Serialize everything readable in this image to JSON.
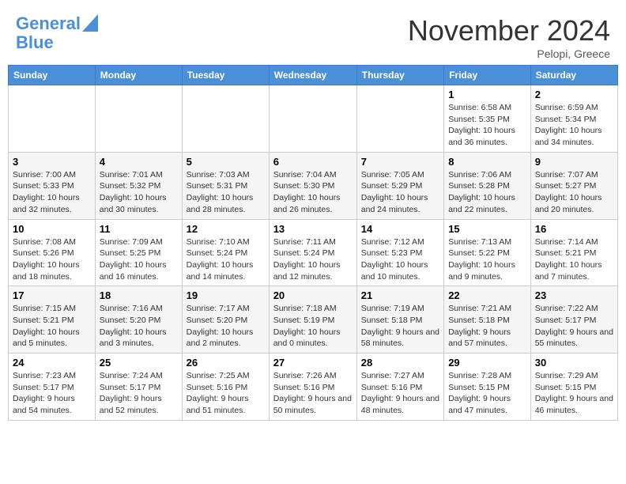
{
  "header": {
    "logo_line1": "General",
    "logo_line2": "Blue",
    "month": "November 2024",
    "location": "Pelopi, Greece"
  },
  "weekdays": [
    "Sunday",
    "Monday",
    "Tuesday",
    "Wednesday",
    "Thursday",
    "Friday",
    "Saturday"
  ],
  "weeks": [
    [
      {
        "day": "",
        "info": ""
      },
      {
        "day": "",
        "info": ""
      },
      {
        "day": "",
        "info": ""
      },
      {
        "day": "",
        "info": ""
      },
      {
        "day": "",
        "info": ""
      },
      {
        "day": "1",
        "info": "Sunrise: 6:58 AM\nSunset: 5:35 PM\nDaylight: 10 hours and 36 minutes."
      },
      {
        "day": "2",
        "info": "Sunrise: 6:59 AM\nSunset: 5:34 PM\nDaylight: 10 hours and 34 minutes."
      }
    ],
    [
      {
        "day": "3",
        "info": "Sunrise: 7:00 AM\nSunset: 5:33 PM\nDaylight: 10 hours and 32 minutes."
      },
      {
        "day": "4",
        "info": "Sunrise: 7:01 AM\nSunset: 5:32 PM\nDaylight: 10 hours and 30 minutes."
      },
      {
        "day": "5",
        "info": "Sunrise: 7:03 AM\nSunset: 5:31 PM\nDaylight: 10 hours and 28 minutes."
      },
      {
        "day": "6",
        "info": "Sunrise: 7:04 AM\nSunset: 5:30 PM\nDaylight: 10 hours and 26 minutes."
      },
      {
        "day": "7",
        "info": "Sunrise: 7:05 AM\nSunset: 5:29 PM\nDaylight: 10 hours and 24 minutes."
      },
      {
        "day": "8",
        "info": "Sunrise: 7:06 AM\nSunset: 5:28 PM\nDaylight: 10 hours and 22 minutes."
      },
      {
        "day": "9",
        "info": "Sunrise: 7:07 AM\nSunset: 5:27 PM\nDaylight: 10 hours and 20 minutes."
      }
    ],
    [
      {
        "day": "10",
        "info": "Sunrise: 7:08 AM\nSunset: 5:26 PM\nDaylight: 10 hours and 18 minutes."
      },
      {
        "day": "11",
        "info": "Sunrise: 7:09 AM\nSunset: 5:25 PM\nDaylight: 10 hours and 16 minutes."
      },
      {
        "day": "12",
        "info": "Sunrise: 7:10 AM\nSunset: 5:24 PM\nDaylight: 10 hours and 14 minutes."
      },
      {
        "day": "13",
        "info": "Sunrise: 7:11 AM\nSunset: 5:24 PM\nDaylight: 10 hours and 12 minutes."
      },
      {
        "day": "14",
        "info": "Sunrise: 7:12 AM\nSunset: 5:23 PM\nDaylight: 10 hours and 10 minutes."
      },
      {
        "day": "15",
        "info": "Sunrise: 7:13 AM\nSunset: 5:22 PM\nDaylight: 10 hours and 9 minutes."
      },
      {
        "day": "16",
        "info": "Sunrise: 7:14 AM\nSunset: 5:21 PM\nDaylight: 10 hours and 7 minutes."
      }
    ],
    [
      {
        "day": "17",
        "info": "Sunrise: 7:15 AM\nSunset: 5:21 PM\nDaylight: 10 hours and 5 minutes."
      },
      {
        "day": "18",
        "info": "Sunrise: 7:16 AM\nSunset: 5:20 PM\nDaylight: 10 hours and 3 minutes."
      },
      {
        "day": "19",
        "info": "Sunrise: 7:17 AM\nSunset: 5:20 PM\nDaylight: 10 hours and 2 minutes."
      },
      {
        "day": "20",
        "info": "Sunrise: 7:18 AM\nSunset: 5:19 PM\nDaylight: 10 hours and 0 minutes."
      },
      {
        "day": "21",
        "info": "Sunrise: 7:19 AM\nSunset: 5:18 PM\nDaylight: 9 hours and 58 minutes."
      },
      {
        "day": "22",
        "info": "Sunrise: 7:21 AM\nSunset: 5:18 PM\nDaylight: 9 hours and 57 minutes."
      },
      {
        "day": "23",
        "info": "Sunrise: 7:22 AM\nSunset: 5:17 PM\nDaylight: 9 hours and 55 minutes."
      }
    ],
    [
      {
        "day": "24",
        "info": "Sunrise: 7:23 AM\nSunset: 5:17 PM\nDaylight: 9 hours and 54 minutes."
      },
      {
        "day": "25",
        "info": "Sunrise: 7:24 AM\nSunset: 5:17 PM\nDaylight: 9 hours and 52 minutes."
      },
      {
        "day": "26",
        "info": "Sunrise: 7:25 AM\nSunset: 5:16 PM\nDaylight: 9 hours and 51 minutes."
      },
      {
        "day": "27",
        "info": "Sunrise: 7:26 AM\nSunset: 5:16 PM\nDaylight: 9 hours and 50 minutes."
      },
      {
        "day": "28",
        "info": "Sunrise: 7:27 AM\nSunset: 5:16 PM\nDaylight: 9 hours and 48 minutes."
      },
      {
        "day": "29",
        "info": "Sunrise: 7:28 AM\nSunset: 5:15 PM\nDaylight: 9 hours and 47 minutes."
      },
      {
        "day": "30",
        "info": "Sunrise: 7:29 AM\nSunset: 5:15 PM\nDaylight: 9 hours and 46 minutes."
      }
    ]
  ]
}
